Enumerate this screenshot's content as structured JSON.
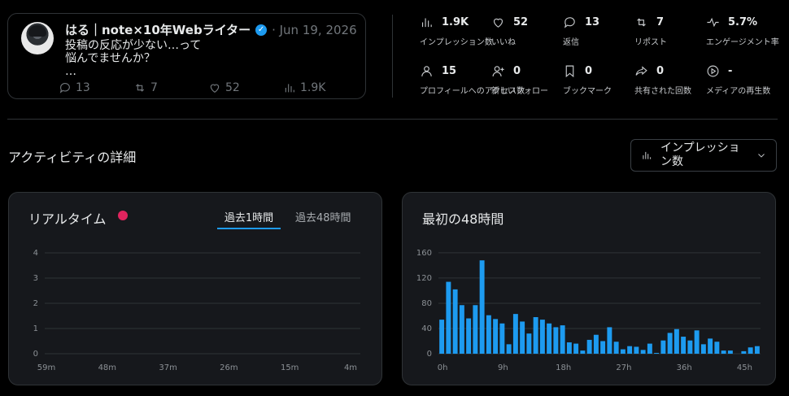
{
  "tweet": {
    "author_name": "はる｜note×10年Webライター",
    "date": "· Jun 19, 2026",
    "text": "投稿の反応が少ない…って\n悩んでませんか？\n…",
    "replies": "13",
    "reposts": "7",
    "likes": "52",
    "views": "1.9K"
  },
  "metrics": [
    {
      "icon": "bar-chart-icon",
      "value": "1.9K",
      "label": "インプレッション数"
    },
    {
      "icon": "heart-icon",
      "value": "52",
      "label": "いいね"
    },
    {
      "icon": "reply-icon",
      "value": "13",
      "label": "返信"
    },
    {
      "icon": "repost-icon",
      "value": "7",
      "label": "リポスト"
    },
    {
      "icon": "engagement-icon",
      "value": "5.7%",
      "label": "エンゲージメント率"
    },
    {
      "icon": "person-icon",
      "value": "15",
      "label": "プロフィールへのアクセス数"
    },
    {
      "icon": "follow-icon",
      "value": "0",
      "label": "新しいフォロー"
    },
    {
      "icon": "bookmark-icon",
      "value": "0",
      "label": "ブックマーク"
    },
    {
      "icon": "share-icon",
      "value": "0",
      "label": "共有された回数"
    },
    {
      "icon": "play-icon",
      "value": "-",
      "label": "メディアの再生数"
    }
  ],
  "activity": {
    "title": "アクティビティの詳細",
    "dropdown_label": "インプレッション数"
  },
  "realtime": {
    "title": "リアルタイム",
    "tabs": [
      "過去1時間",
      "過去48時間"
    ],
    "live_color": "#e0245e"
  },
  "first48": {
    "title": "最初の48時間"
  },
  "chart_data": [
    {
      "type": "bar",
      "title": "リアルタイム",
      "xlabel": "",
      "ylabel": "",
      "x_ticks": [
        "59m",
        "48m",
        "37m",
        "26m",
        "15m",
        "4m"
      ],
      "y_ticks": [
        "0",
        "1",
        "2",
        "3",
        "4"
      ],
      "ylim": [
        0,
        4
      ],
      "values": [],
      "grid": true
    },
    {
      "type": "bar",
      "title": "最初の48時間",
      "xlabel": "",
      "ylabel": "",
      "x_ticks": [
        "0h",
        "9h",
        "18h",
        "27h",
        "36h",
        "45h"
      ],
      "y_ticks": [
        "0",
        "40",
        "80",
        "120",
        "160"
      ],
      "ylim": [
        0,
        165
      ],
      "values": [
        54,
        114,
        102,
        77,
        56,
        77,
        148,
        61,
        55,
        48,
        15,
        63,
        51,
        32,
        58,
        54,
        48,
        42,
        45,
        18,
        16,
        5,
        22,
        30,
        20,
        42,
        19,
        7,
        12,
        11,
        6,
        16,
        1,
        21,
        33,
        39,
        27,
        21,
        37,
        15,
        24,
        19,
        5,
        5,
        0,
        4,
        10,
        12
      ],
      "bar_color": "#1d9bf0",
      "grid": true
    }
  ]
}
